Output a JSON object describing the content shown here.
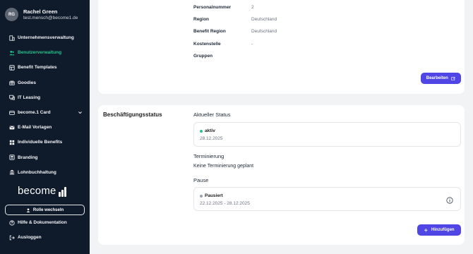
{
  "user": {
    "initials": "RG",
    "name": "Rachel Green",
    "email": "test.mensch@become1.de"
  },
  "nav": [
    {
      "label": "Unternehmensverwaltung",
      "icon": "building-icon"
    },
    {
      "label": "Benutzerverwaltung",
      "icon": "users-icon"
    },
    {
      "label": "Benefit Templates",
      "icon": "template-icon"
    },
    {
      "label": "Goodies",
      "icon": "gift-icon"
    },
    {
      "label": "IT Leasing",
      "icon": "devices-icon"
    },
    {
      "label": "become.1 Card",
      "icon": "card-icon"
    },
    {
      "label": "E-Mail Vorlagen",
      "icon": "mail-icon"
    },
    {
      "label": "Individuelle Benefits",
      "icon": "grid-icon"
    },
    {
      "label": "Branding",
      "icon": "branding-icon"
    },
    {
      "label": "Lohnbuchhaltung",
      "icon": "bank-icon"
    }
  ],
  "brand": "become",
  "role_switch": "Rolle wechseln",
  "bottom_nav": [
    {
      "label": "Hilfe & Dokumentation",
      "icon": "help-icon"
    },
    {
      "label": "Ausloggen",
      "icon": "logout-icon"
    }
  ],
  "details": {
    "rows": [
      {
        "key": "Personalnummer",
        "value": "2"
      },
      {
        "key": "Region",
        "value": "Deutschland"
      },
      {
        "key": "Benefit Region",
        "value": "Deutschland"
      },
      {
        "key": "Kostenstelle",
        "value": "-"
      },
      {
        "key": "Gruppen",
        "value": ""
      }
    ],
    "edit_label": "Bearbeiten"
  },
  "employment": {
    "title": "Beschäftigungsstatus",
    "current_status_label": "Aktueller Status",
    "status": "aktiv",
    "status_date": "28.12.2025",
    "termination_label": "Terminierung",
    "termination_text": "Keine Terminierung geplant",
    "pause_label": "Pause",
    "pause_status": "Pausiert",
    "pause_range": "22.12.2025 - 28.12.2025",
    "add_label": "Hinzufügen"
  },
  "colors": {
    "sidebar": "#0f1a2b",
    "active": "#22c58b",
    "primary": "#4f46e5",
    "status_active": "#22c58b",
    "status_paused": "#9ca3af"
  }
}
